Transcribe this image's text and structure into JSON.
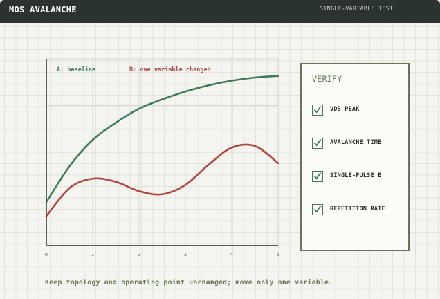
{
  "window": {
    "title": "MOS AVALANCHE",
    "mode": "SINGLE-VARIABLE TEST"
  },
  "colors": {
    "baseline": "#3d7a57",
    "changed": "#b04540",
    "axis": "#5c605b",
    "grid": "#d6d9d0",
    "panel_border": "#67735f"
  },
  "chart_data": {
    "type": "line",
    "xlim": [
      0,
      5
    ],
    "x_ticks": [
      "0",
      "1",
      "2",
      "3",
      "4",
      "5"
    ],
    "grid": true,
    "legend_placement": "top-left",
    "series": [
      {
        "name": "A: baseline",
        "color": "#3d7a57",
        "x": [
          0,
          0.5,
          1,
          1.5,
          2,
          2.5,
          3,
          3.5,
          4,
          4.5,
          5
        ],
        "y": [
          0.28,
          0.51,
          0.68,
          0.79,
          0.88,
          0.94,
          0.99,
          1.03,
          1.06,
          1.08,
          1.09
        ]
      },
      {
        "name": "B: one variable changed",
        "color": "#b04540",
        "x": [
          0,
          0.5,
          1,
          1.5,
          2,
          2.5,
          3,
          3.5,
          4,
          4.5,
          5
        ],
        "y": [
          0.19,
          0.37,
          0.43,
          0.41,
          0.35,
          0.33,
          0.39,
          0.52,
          0.63,
          0.64,
          0.53
        ]
      }
    ]
  },
  "verify": {
    "title": "VERIFY",
    "items": [
      {
        "label": "VDS PEAK",
        "checked": true
      },
      {
        "label": "AVALANCHE TIME",
        "checked": true
      },
      {
        "label": "SINGLE-PULSE E",
        "checked": true
      },
      {
        "label": "REPETITION RATE",
        "checked": true
      }
    ]
  },
  "footer": {
    "note": "Keep topology and operating point unchanged; move only one variable."
  }
}
